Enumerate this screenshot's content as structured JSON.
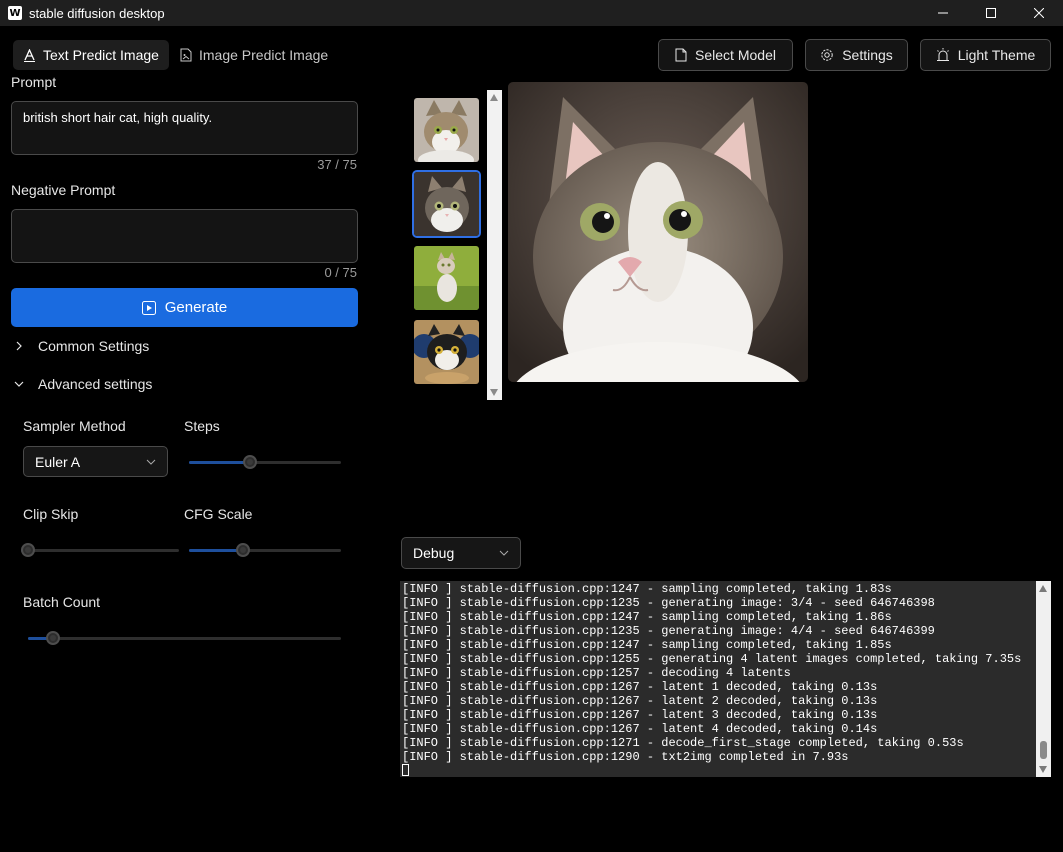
{
  "window": {
    "title": "stable diffusion desktop",
    "logo_letter": "W"
  },
  "tabs": [
    {
      "label": "Text Predict Image",
      "active": true
    },
    {
      "label": "Image Predict Image",
      "active": false
    }
  ],
  "toolbar": {
    "select_model": "Select Model",
    "settings": "Settings",
    "theme": "Light Theme"
  },
  "prompt": {
    "label": "Prompt",
    "value": "british short hair cat, high quality.",
    "counter": "37 / 75"
  },
  "negative_prompt": {
    "label": "Negative Prompt",
    "value": "",
    "counter": "0 / 75"
  },
  "generate_label": "Generate",
  "sections": {
    "common": "Common Settings",
    "advanced": "Advanced settings"
  },
  "advanced": {
    "sampler_label": "Sampler Method",
    "sampler_value": "Euler A",
    "steps_label": "Steps",
    "steps_level": 0.39,
    "clip_skip_label": "Clip Skip",
    "clip_skip_level": 0.0,
    "cfg_label": "CFG Scale",
    "cfg_level": 0.34,
    "batch_label": "Batch Count",
    "batch_level": 0.06
  },
  "gallery": {
    "selected_index": 1,
    "count": 4
  },
  "log": {
    "level_value": "Debug",
    "lines": [
      "[INFO ] stable-diffusion.cpp:1247 - sampling completed, taking 1.83s",
      "[INFO ] stable-diffusion.cpp:1235 - generating image: 3/4 - seed 646746398",
      "[INFO ] stable-diffusion.cpp:1247 - sampling completed, taking 1.86s",
      "[INFO ] stable-diffusion.cpp:1235 - generating image: 4/4 - seed 646746399",
      "[INFO ] stable-diffusion.cpp:1247 - sampling completed, taking 1.85s",
      "[INFO ] stable-diffusion.cpp:1255 - generating 4 latent images completed, taking 7.35s",
      "[INFO ] stable-diffusion.cpp:1257 - decoding 4 latents",
      "[INFO ] stable-diffusion.cpp:1267 - latent 1 decoded, taking 0.13s",
      "[INFO ] stable-diffusion.cpp:1267 - latent 2 decoded, taking 0.13s",
      "[INFO ] stable-diffusion.cpp:1267 - latent 3 decoded, taking 0.13s",
      "[INFO ] stable-diffusion.cpp:1267 - latent 4 decoded, taking 0.14s",
      "[INFO ] stable-diffusion.cpp:1271 - decode_first_stage completed, taking 0.53s",
      "[INFO ] stable-diffusion.cpp:1290 - txt2img completed in 7.93s"
    ]
  },
  "colors": {
    "accent": "#1a6be0",
    "selected_border": "#2f6fe4",
    "background": "#000000"
  }
}
